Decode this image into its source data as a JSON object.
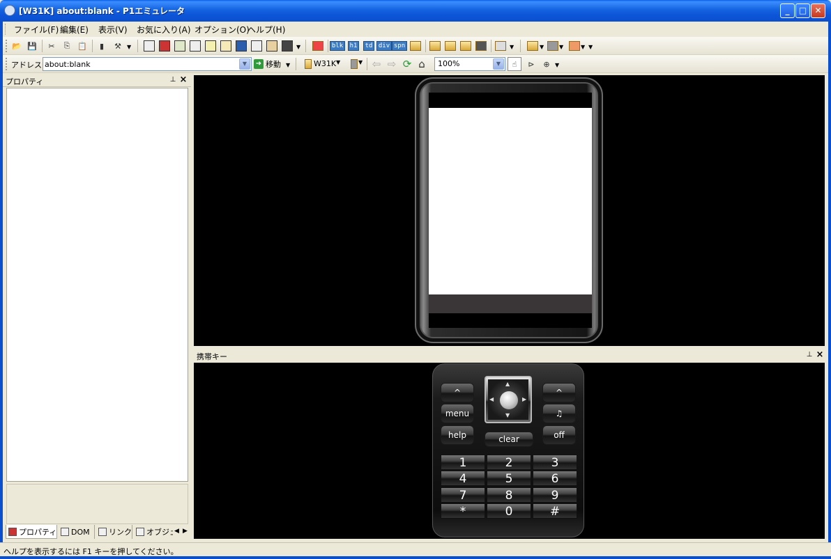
{
  "window": {
    "title": "[W31K] about:blank - P1エミュレータ",
    "minimize": "_",
    "maximize": "□",
    "close": "✕"
  },
  "menu": [
    "ファイル(F)",
    "編集(E)",
    "表示(V)",
    "お気に入り(A)",
    "オプション(O)",
    "ヘルプ(H)"
  ],
  "toolbar1": {
    "tag_buttons": [
      "blk",
      "h1",
      "td",
      "div",
      "spn"
    ]
  },
  "address": {
    "label": "アドレス",
    "value": "about:blank",
    "go_label": "移動",
    "device_label": "W31K",
    "zoom": "100%"
  },
  "properties_panel": {
    "title": "プロパティ",
    "tabs": [
      "プロパティ",
      "DOM",
      "リンク",
      "オブジェクト"
    ]
  },
  "keypad_panel": {
    "title": "携帯キー",
    "keys": {
      "up_left": "^",
      "up_right": "^",
      "menu": "menu",
      "help": "help",
      "clear": "clear",
      "off": "off",
      "numbers": [
        "1",
        "2",
        "3",
        "4",
        "5",
        "6",
        "7",
        "8",
        "9",
        "*",
        "0",
        "#"
      ]
    }
  },
  "status": {
    "text": "ヘルプを表示するには F1 キーを押してください。"
  },
  "colors": {
    "titlebar": "#0a5fe6",
    "chrome": "#ece9d8",
    "emulator_bg": "#000000"
  }
}
